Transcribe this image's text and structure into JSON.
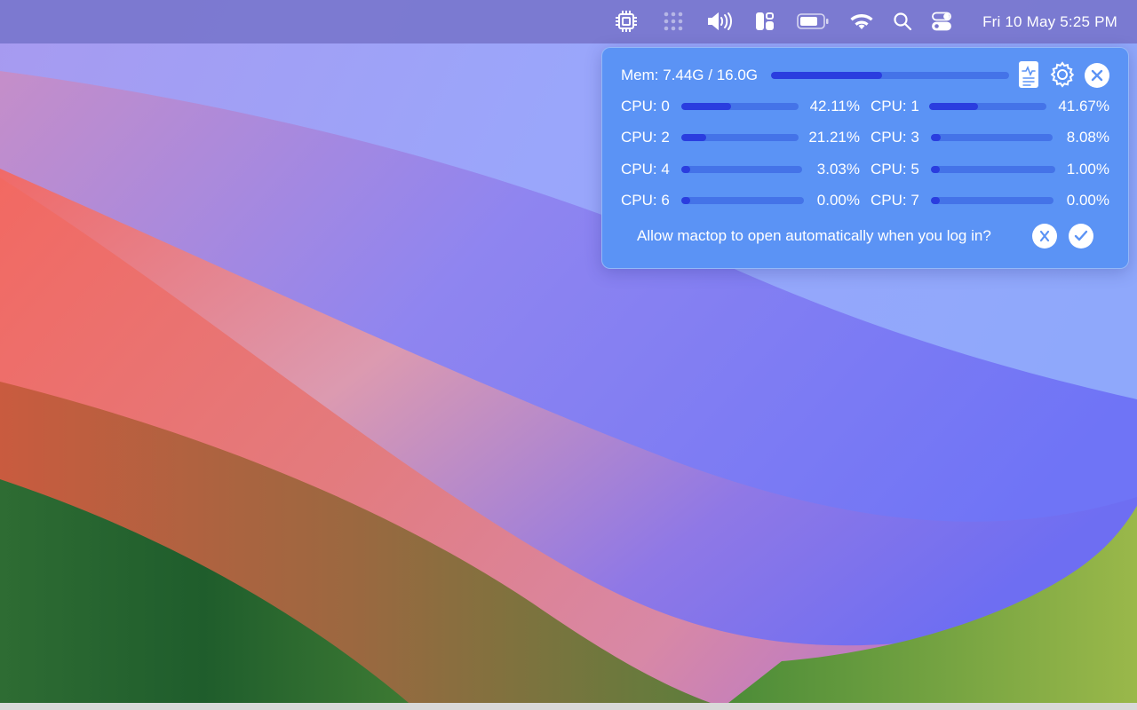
{
  "menubar": {
    "icons": [
      "cpu-chip-icon",
      "dots-grid-icon",
      "volume-icon",
      "layout-grid-icon",
      "battery-icon",
      "wifi-icon",
      "search-icon",
      "control-center-icon"
    ],
    "datetime": "Fri 10 May  5:25 PM"
  },
  "popover": {
    "memory": {
      "label": "Mem: 7.44G / 16.0G",
      "used": 7.44,
      "total": 16.0
    },
    "actions": [
      "activity-monitor-icon",
      "settings-icon",
      "close-icon"
    ],
    "cpus": [
      {
        "label": "CPU: 0",
        "value": "42.11%",
        "pct": 42.11
      },
      {
        "label": "CPU: 1",
        "value": "41.67%",
        "pct": 41.67
      },
      {
        "label": "CPU: 2",
        "value": "21.21%",
        "pct": 21.21
      },
      {
        "label": "CPU: 3",
        "value": "8.08%",
        "pct": 8.08
      },
      {
        "label": "CPU: 4",
        "value": "3.03%",
        "pct": 3.03
      },
      {
        "label": "CPU: 5",
        "value": "1.00%",
        "pct": 1.0
      },
      {
        "label": "CPU: 6",
        "value": "0.00%",
        "pct": 0.0
      },
      {
        "label": "CPU: 7",
        "value": "0.00%",
        "pct": 0.0
      }
    ],
    "login_prompt": {
      "question": "Allow mactop to open automatically when you log in?",
      "deny_icon": "x-icon",
      "accept_icon": "check-icon"
    }
  },
  "colors": {
    "popover_bg": "#5b93f5",
    "bar_fill": "#2a3ddf",
    "menubar_bg": "#7876cd"
  }
}
